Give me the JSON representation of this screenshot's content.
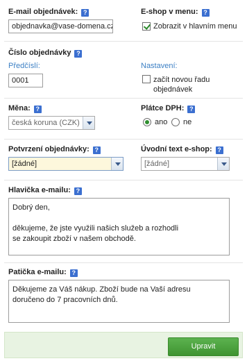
{
  "email": {
    "label": "E-mail objednávek:",
    "value": "objednavka@vase-domena.cz"
  },
  "eshop_menu": {
    "label": "E-shop v menu:",
    "checkbox_label": "Zobrazit v hlavním menu",
    "checked": true
  },
  "order_number": {
    "label": "Číslo objednávky",
    "prefix_label": "Předčíslí:",
    "prefix_value": "0001",
    "settings_label": "Nastavení:",
    "reset_label_line1": "začít novou řadu",
    "reset_label_line2": "objednávek",
    "reset_checked": false
  },
  "currency": {
    "label": "Měna:",
    "selected": "česká koruna (CZK)"
  },
  "vat": {
    "label": "Plátce DPH:",
    "yes_label": "ano",
    "no_label": "ne",
    "selected": "ano"
  },
  "confirmation": {
    "label": "Potvrzení objednávky:",
    "selected": "[žádné]"
  },
  "intro_text": {
    "label": "Úvodní text e-shop:",
    "selected": "[žádné]"
  },
  "header": {
    "label": "Hlavička e-mailu:",
    "value": "Dobrý den,\n\nděkujeme, že jste využili našich služeb a rozhodli\nse zakoupit zboží v našem obchodě."
  },
  "footer": {
    "label": "Patička e-mailu:",
    "value": "Děkujeme za Váš nákup. Zboží bude na Vaší adresu\ndoručeno do 7 pracovních dnů."
  },
  "submit": {
    "label": "Upravit"
  },
  "help_glyph": "?",
  "colors": {
    "accent_blue": "#3b6fd0",
    "link_blue": "#3b7fc4",
    "button_green": "#4aa33c",
    "footer_bg": "#e8f3e2"
  }
}
